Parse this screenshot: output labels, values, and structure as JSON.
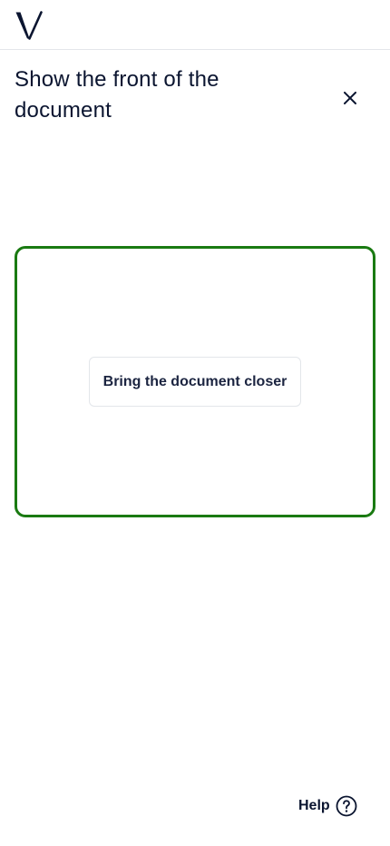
{
  "header": {
    "logo_icon": "verification-v-logo"
  },
  "main": {
    "title": "Show the front of the document",
    "close_icon": "close-icon",
    "frame_color": "#1a7a12",
    "hint": "Bring the document closer"
  },
  "footer": {
    "help_label": "Help",
    "help_icon": "question-circle-icon"
  },
  "colors": {
    "text": "#0b1530",
    "frame": "#1a7a12"
  }
}
